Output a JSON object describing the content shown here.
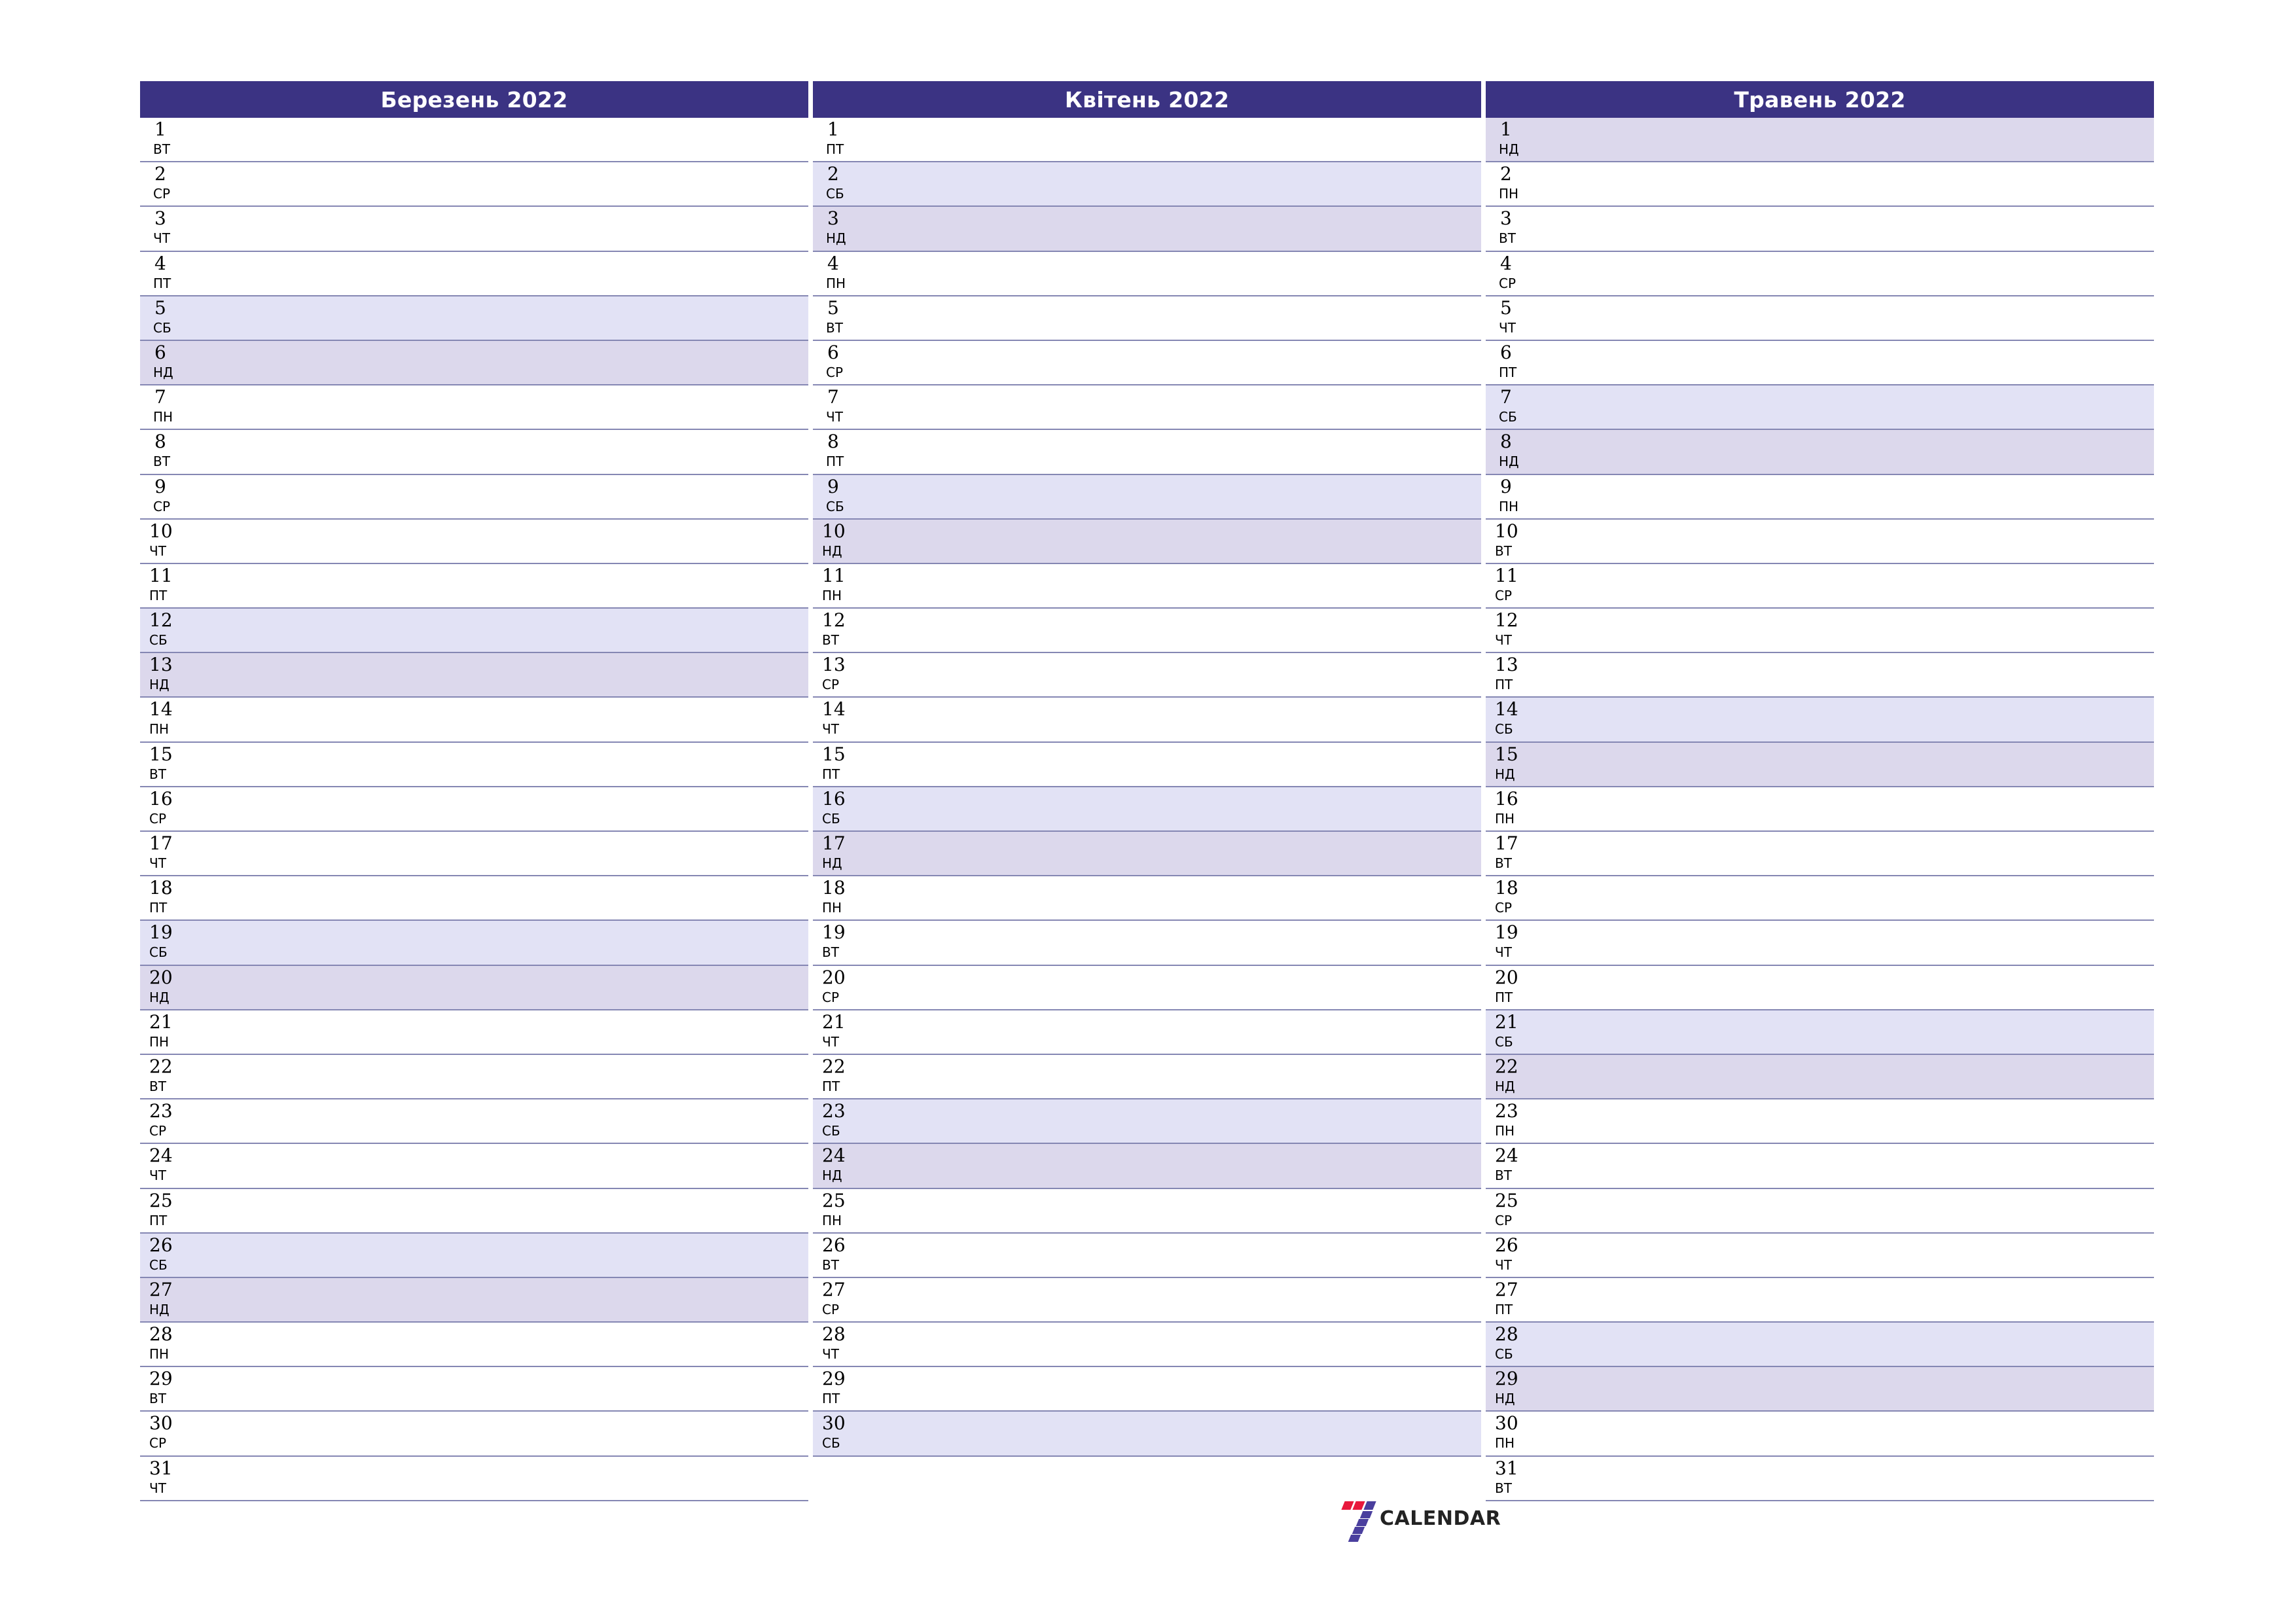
{
  "colors": {
    "header_bg": "#3B3383",
    "header_text": "#FFFFFF",
    "saturday_bg": "#E2E2F5",
    "sunday_bg": "#DCD8EC",
    "row_line": "#8587B3",
    "page_bg": "#FFFFFF",
    "logo_red": "#E8193C",
    "logo_purple": "#4A3F9E",
    "logo_text": "#232323"
  },
  "logo": {
    "mark": "seven-logo-icon",
    "text": "CALENDAR"
  },
  "months": [
    {
      "title": "Березень 2022",
      "days": [
        {
          "num": "1",
          "wd": "ВТ",
          "type": "weekday"
        },
        {
          "num": "2",
          "wd": "СР",
          "type": "weekday"
        },
        {
          "num": "3",
          "wd": "ЧТ",
          "type": "weekday"
        },
        {
          "num": "4",
          "wd": "ПТ",
          "type": "weekday"
        },
        {
          "num": "5",
          "wd": "СБ",
          "type": "saturday"
        },
        {
          "num": "6",
          "wd": "НД",
          "type": "sunday"
        },
        {
          "num": "7",
          "wd": "ПН",
          "type": "weekday"
        },
        {
          "num": "8",
          "wd": "ВТ",
          "type": "weekday"
        },
        {
          "num": "9",
          "wd": "СР",
          "type": "weekday"
        },
        {
          "num": "10",
          "wd": "ЧТ",
          "type": "weekday"
        },
        {
          "num": "11",
          "wd": "ПТ",
          "type": "weekday"
        },
        {
          "num": "12",
          "wd": "СБ",
          "type": "saturday"
        },
        {
          "num": "13",
          "wd": "НД",
          "type": "sunday"
        },
        {
          "num": "14",
          "wd": "ПН",
          "type": "weekday"
        },
        {
          "num": "15",
          "wd": "ВТ",
          "type": "weekday"
        },
        {
          "num": "16",
          "wd": "СР",
          "type": "weekday"
        },
        {
          "num": "17",
          "wd": "ЧТ",
          "type": "weekday"
        },
        {
          "num": "18",
          "wd": "ПТ",
          "type": "weekday"
        },
        {
          "num": "19",
          "wd": "СБ",
          "type": "saturday"
        },
        {
          "num": "20",
          "wd": "НД",
          "type": "sunday"
        },
        {
          "num": "21",
          "wd": "ПН",
          "type": "weekday"
        },
        {
          "num": "22",
          "wd": "ВТ",
          "type": "weekday"
        },
        {
          "num": "23",
          "wd": "СР",
          "type": "weekday"
        },
        {
          "num": "24",
          "wd": "ЧТ",
          "type": "weekday"
        },
        {
          "num": "25",
          "wd": "ПТ",
          "type": "weekday"
        },
        {
          "num": "26",
          "wd": "СБ",
          "type": "saturday"
        },
        {
          "num": "27",
          "wd": "НД",
          "type": "sunday"
        },
        {
          "num": "28",
          "wd": "ПН",
          "type": "weekday"
        },
        {
          "num": "29",
          "wd": "ВТ",
          "type": "weekday"
        },
        {
          "num": "30",
          "wd": "СР",
          "type": "weekday"
        },
        {
          "num": "31",
          "wd": "ЧТ",
          "type": "weekday"
        }
      ]
    },
    {
      "title": "Квітень 2022",
      "days": [
        {
          "num": "1",
          "wd": "ПТ",
          "type": "weekday"
        },
        {
          "num": "2",
          "wd": "СБ",
          "type": "saturday"
        },
        {
          "num": "3",
          "wd": "НД",
          "type": "sunday"
        },
        {
          "num": "4",
          "wd": "ПН",
          "type": "weekday"
        },
        {
          "num": "5",
          "wd": "ВТ",
          "type": "weekday"
        },
        {
          "num": "6",
          "wd": "СР",
          "type": "weekday"
        },
        {
          "num": "7",
          "wd": "ЧТ",
          "type": "weekday"
        },
        {
          "num": "8",
          "wd": "ПТ",
          "type": "weekday"
        },
        {
          "num": "9",
          "wd": "СБ",
          "type": "saturday"
        },
        {
          "num": "10",
          "wd": "НД",
          "type": "sunday"
        },
        {
          "num": "11",
          "wd": "ПН",
          "type": "weekday"
        },
        {
          "num": "12",
          "wd": "ВТ",
          "type": "weekday"
        },
        {
          "num": "13",
          "wd": "СР",
          "type": "weekday"
        },
        {
          "num": "14",
          "wd": "ЧТ",
          "type": "weekday"
        },
        {
          "num": "15",
          "wd": "ПТ",
          "type": "weekday"
        },
        {
          "num": "16",
          "wd": "СБ",
          "type": "saturday"
        },
        {
          "num": "17",
          "wd": "НД",
          "type": "sunday"
        },
        {
          "num": "18",
          "wd": "ПН",
          "type": "weekday"
        },
        {
          "num": "19",
          "wd": "ВТ",
          "type": "weekday"
        },
        {
          "num": "20",
          "wd": "СР",
          "type": "weekday"
        },
        {
          "num": "21",
          "wd": "ЧТ",
          "type": "weekday"
        },
        {
          "num": "22",
          "wd": "ПТ",
          "type": "weekday"
        },
        {
          "num": "23",
          "wd": "СБ",
          "type": "saturday"
        },
        {
          "num": "24",
          "wd": "НД",
          "type": "sunday"
        },
        {
          "num": "25",
          "wd": "ПН",
          "type": "weekday"
        },
        {
          "num": "26",
          "wd": "ВТ",
          "type": "weekday"
        },
        {
          "num": "27",
          "wd": "СР",
          "type": "weekday"
        },
        {
          "num": "28",
          "wd": "ЧТ",
          "type": "weekday"
        },
        {
          "num": "29",
          "wd": "ПТ",
          "type": "weekday"
        },
        {
          "num": "30",
          "wd": "СБ",
          "type": "saturday"
        }
      ]
    },
    {
      "title": "Травень 2022",
      "days": [
        {
          "num": "1",
          "wd": "НД",
          "type": "sunday"
        },
        {
          "num": "2",
          "wd": "ПН",
          "type": "weekday"
        },
        {
          "num": "3",
          "wd": "ВТ",
          "type": "weekday"
        },
        {
          "num": "4",
          "wd": "СР",
          "type": "weekday"
        },
        {
          "num": "5",
          "wd": "ЧТ",
          "type": "weekday"
        },
        {
          "num": "6",
          "wd": "ПТ",
          "type": "weekday"
        },
        {
          "num": "7",
          "wd": "СБ",
          "type": "saturday"
        },
        {
          "num": "8",
          "wd": "НД",
          "type": "sunday"
        },
        {
          "num": "9",
          "wd": "ПН",
          "type": "weekday"
        },
        {
          "num": "10",
          "wd": "ВТ",
          "type": "weekday"
        },
        {
          "num": "11",
          "wd": "СР",
          "type": "weekday"
        },
        {
          "num": "12",
          "wd": "ЧТ",
          "type": "weekday"
        },
        {
          "num": "13",
          "wd": "ПТ",
          "type": "weekday"
        },
        {
          "num": "14",
          "wd": "СБ",
          "type": "saturday"
        },
        {
          "num": "15",
          "wd": "НД",
          "type": "sunday"
        },
        {
          "num": "16",
          "wd": "ПН",
          "type": "weekday"
        },
        {
          "num": "17",
          "wd": "ВТ",
          "type": "weekday"
        },
        {
          "num": "18",
          "wd": "СР",
          "type": "weekday"
        },
        {
          "num": "19",
          "wd": "ЧТ",
          "type": "weekday"
        },
        {
          "num": "20",
          "wd": "ПТ",
          "type": "weekday"
        },
        {
          "num": "21",
          "wd": "СБ",
          "type": "saturday"
        },
        {
          "num": "22",
          "wd": "НД",
          "type": "sunday"
        },
        {
          "num": "23",
          "wd": "ПН",
          "type": "weekday"
        },
        {
          "num": "24",
          "wd": "ВТ",
          "type": "weekday"
        },
        {
          "num": "25",
          "wd": "СР",
          "type": "weekday"
        },
        {
          "num": "26",
          "wd": "ЧТ",
          "type": "weekday"
        },
        {
          "num": "27",
          "wd": "ПТ",
          "type": "weekday"
        },
        {
          "num": "28",
          "wd": "СБ",
          "type": "saturday"
        },
        {
          "num": "29",
          "wd": "НД",
          "type": "sunday"
        },
        {
          "num": "30",
          "wd": "ПН",
          "type": "weekday"
        },
        {
          "num": "31",
          "wd": "ВТ",
          "type": "weekday"
        }
      ]
    }
  ]
}
